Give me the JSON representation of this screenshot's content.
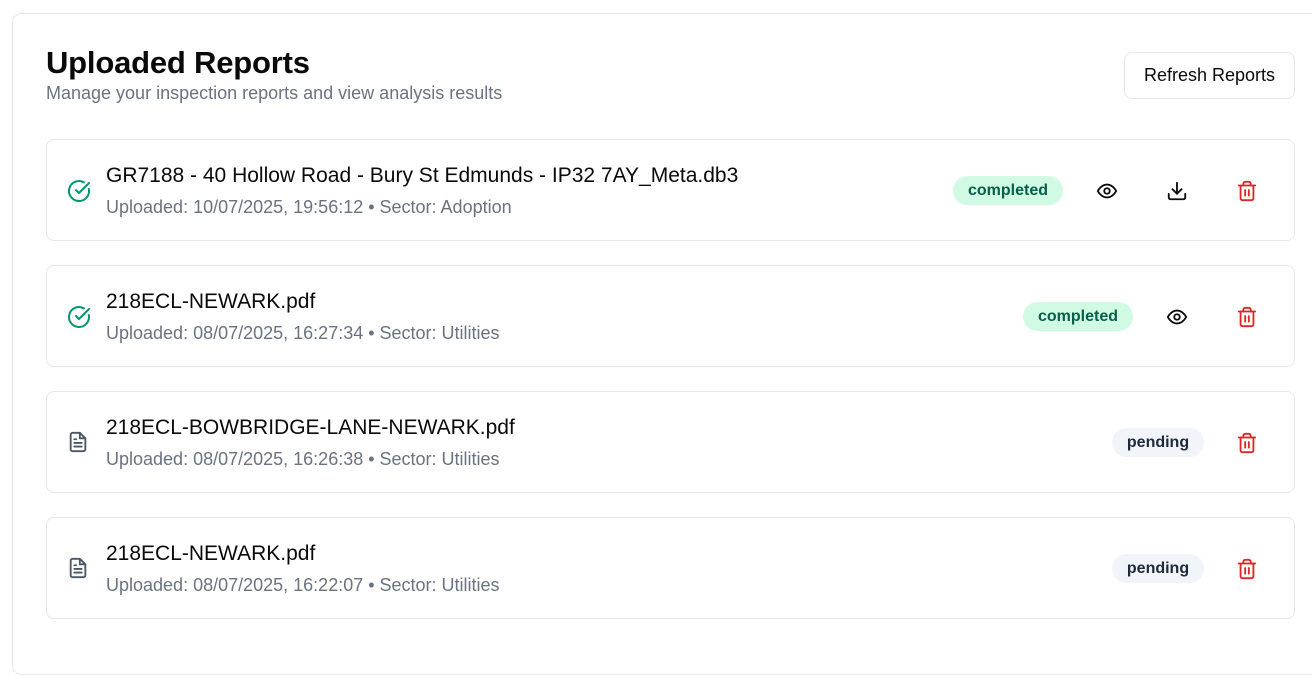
{
  "header": {
    "title": "Uploaded Reports",
    "subtitle": "Manage your inspection reports and view analysis results",
    "refresh_label": "Refresh Reports"
  },
  "colors": {
    "completed_bg": "#d1fae5",
    "completed_text": "#065f46",
    "pending_bg": "#f1f5f9",
    "delete": "#dc2626",
    "success_icon": "#059669"
  },
  "reports": [
    {
      "name": "GR7188 - 40 Hollow Road - Bury St Edmunds - IP32 7AY_Meta.db3",
      "meta": "Uploaded: 10/07/2025, 19:56:12 • Sector: Adoption",
      "status": "completed",
      "icon": "check-circle-icon",
      "actions": [
        "view-icon",
        "download-icon",
        "trash-icon"
      ]
    },
    {
      "name": "218ECL-NEWARK.pdf",
      "meta": "Uploaded: 08/07/2025, 16:27:34 • Sector: Utilities",
      "status": "completed",
      "icon": "check-circle-icon",
      "actions": [
        "view-icon",
        "trash-icon"
      ]
    },
    {
      "name": "218ECL-BOWBRIDGE-LANE-NEWARK.pdf",
      "meta": "Uploaded: 08/07/2025, 16:26:38 • Sector: Utilities",
      "status": "pending",
      "icon": "file-text-icon",
      "actions": [
        "trash-icon"
      ]
    },
    {
      "name": "218ECL-NEWARK.pdf",
      "meta": "Uploaded: 08/07/2025, 16:22:07 • Sector: Utilities",
      "status": "pending",
      "icon": "file-text-icon",
      "actions": [
        "trash-icon"
      ]
    }
  ]
}
